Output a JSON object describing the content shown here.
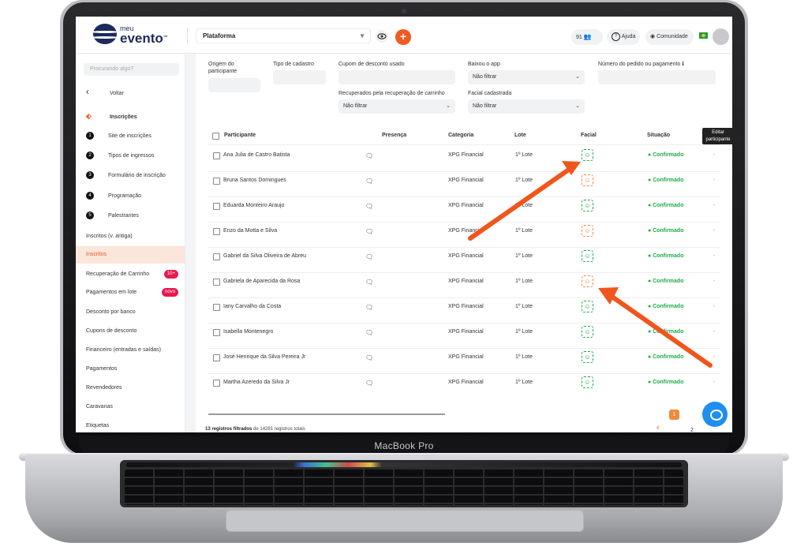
{
  "device": {
    "label": "MacBook Pro"
  },
  "header": {
    "logo_top": "meu",
    "logo_bottom": "evento",
    "logo_tm": "™",
    "platform_select": "Plataforma",
    "plus_label": "+",
    "attendee_count": "91",
    "help_label": "Ajuda",
    "community_label": "Comunidade"
  },
  "sidebar": {
    "search_placeholder": "Procurando algo?",
    "back_label": "Voltar",
    "section_label": "Inscrições",
    "steps": [
      {
        "num": "1",
        "label": "Site de inscrições"
      },
      {
        "num": "2",
        "label": "Tipos de ingressos"
      },
      {
        "num": "3",
        "label": "Formulário de inscrição"
      },
      {
        "num": "4",
        "label": "Programação"
      },
      {
        "num": "5",
        "label": "Palestrantes"
      }
    ],
    "items": [
      {
        "label": "Inscritos (v. antiga)"
      },
      {
        "label": "Inscritos"
      },
      {
        "label": "Recuperação de Carrinho",
        "badge": "10+"
      },
      {
        "label": "Pagamentos em lote",
        "badge": "novo"
      },
      {
        "label": "Desconto por banco"
      },
      {
        "label": "Cupons de desconto"
      },
      {
        "label": "Financeiro (entradas e saídas)"
      },
      {
        "label": "Pagamentos"
      },
      {
        "label": "Revendedores"
      },
      {
        "label": "Caravanas"
      },
      {
        "label": "Etiquetas"
      }
    ],
    "active_item": "Inscritos"
  },
  "filters": {
    "origem_label": "Origem do participante",
    "tipo_label": "Tipo de cadastro",
    "cupom_label": "Cupom de desconto usado",
    "baixou_label": "Baixou o app",
    "baixou_value": "Não filtrar",
    "pedido_label": "Número do pedido ou pagamento",
    "pedido_info_icon": "ℹ",
    "recuperados_label": "Recuperados pela recuperação de carrinho",
    "recuperados_value": "Não filtrar",
    "facial_label": "Facial cadastrada",
    "facial_value": "Não filtrar"
  },
  "table": {
    "columns": [
      "Participante",
      "Presença",
      "Categoria",
      "Lote",
      "Facial",
      "Situação"
    ],
    "rows": [
      {
        "name": "Ana Julia de Castro Batista",
        "category": "XPG Financial",
        "lot": "1º Lote",
        "facial": "green",
        "status": "Confirmado"
      },
      {
        "name": "Bruna Santos Domingues",
        "category": "XPG Financial",
        "lot": "1º Lote",
        "facial": "orange",
        "status": "Confirmado"
      },
      {
        "name": "Eduarda Monteiro Araujo",
        "category": "XPG Financial",
        "lot": "1º Lote",
        "facial": "green",
        "status": "Confirmado"
      },
      {
        "name": "Enzo da Motta e Silva",
        "category": "XPG Financial",
        "lot": "1º Lote",
        "facial": "orange",
        "status": "Confirmado"
      },
      {
        "name": "Gabriel da Silva Oliveira de Abreu",
        "category": "XPG Financial",
        "lot": "1º Lote",
        "facial": "green",
        "status": "Confirmado"
      },
      {
        "name": "Gabriela de Aparecida da Rosa",
        "category": "XPG Financial",
        "lot": "1º Lote",
        "facial": "orange",
        "status": "Confirmado"
      },
      {
        "name": "Iany Carvalho da Costa",
        "category": "XPG Financial",
        "lot": "1º Lote",
        "facial": "green",
        "status": "Confirmado"
      },
      {
        "name": "Isabella Montenegro",
        "category": "XPG Financial",
        "lot": "1º Lote",
        "facial": "green",
        "status": "Confirmado"
      },
      {
        "name": "José Henrique da Silva Pereira Jr",
        "category": "XPG Financial",
        "lot": "1º Lote",
        "facial": "green",
        "status": "Confirmado"
      },
      {
        "name": "Martha Azeredo da Silva Jr",
        "category": "XPG Financial",
        "lot": "1º Lote",
        "facial": "green",
        "status": "Confirmado"
      }
    ],
    "row_action": "-",
    "tooltip": "Editar participante"
  },
  "footer": {
    "count_bold": "13 registros filtrados",
    "count_rest": "de 14281 registros totais",
    "prev": "‹",
    "page_current": "1",
    "page_next": "2"
  },
  "colors": {
    "accent": "#f15a22",
    "green": "#1faa4a",
    "orange": "#f08a3c",
    "navy": "#1c2a5c"
  }
}
